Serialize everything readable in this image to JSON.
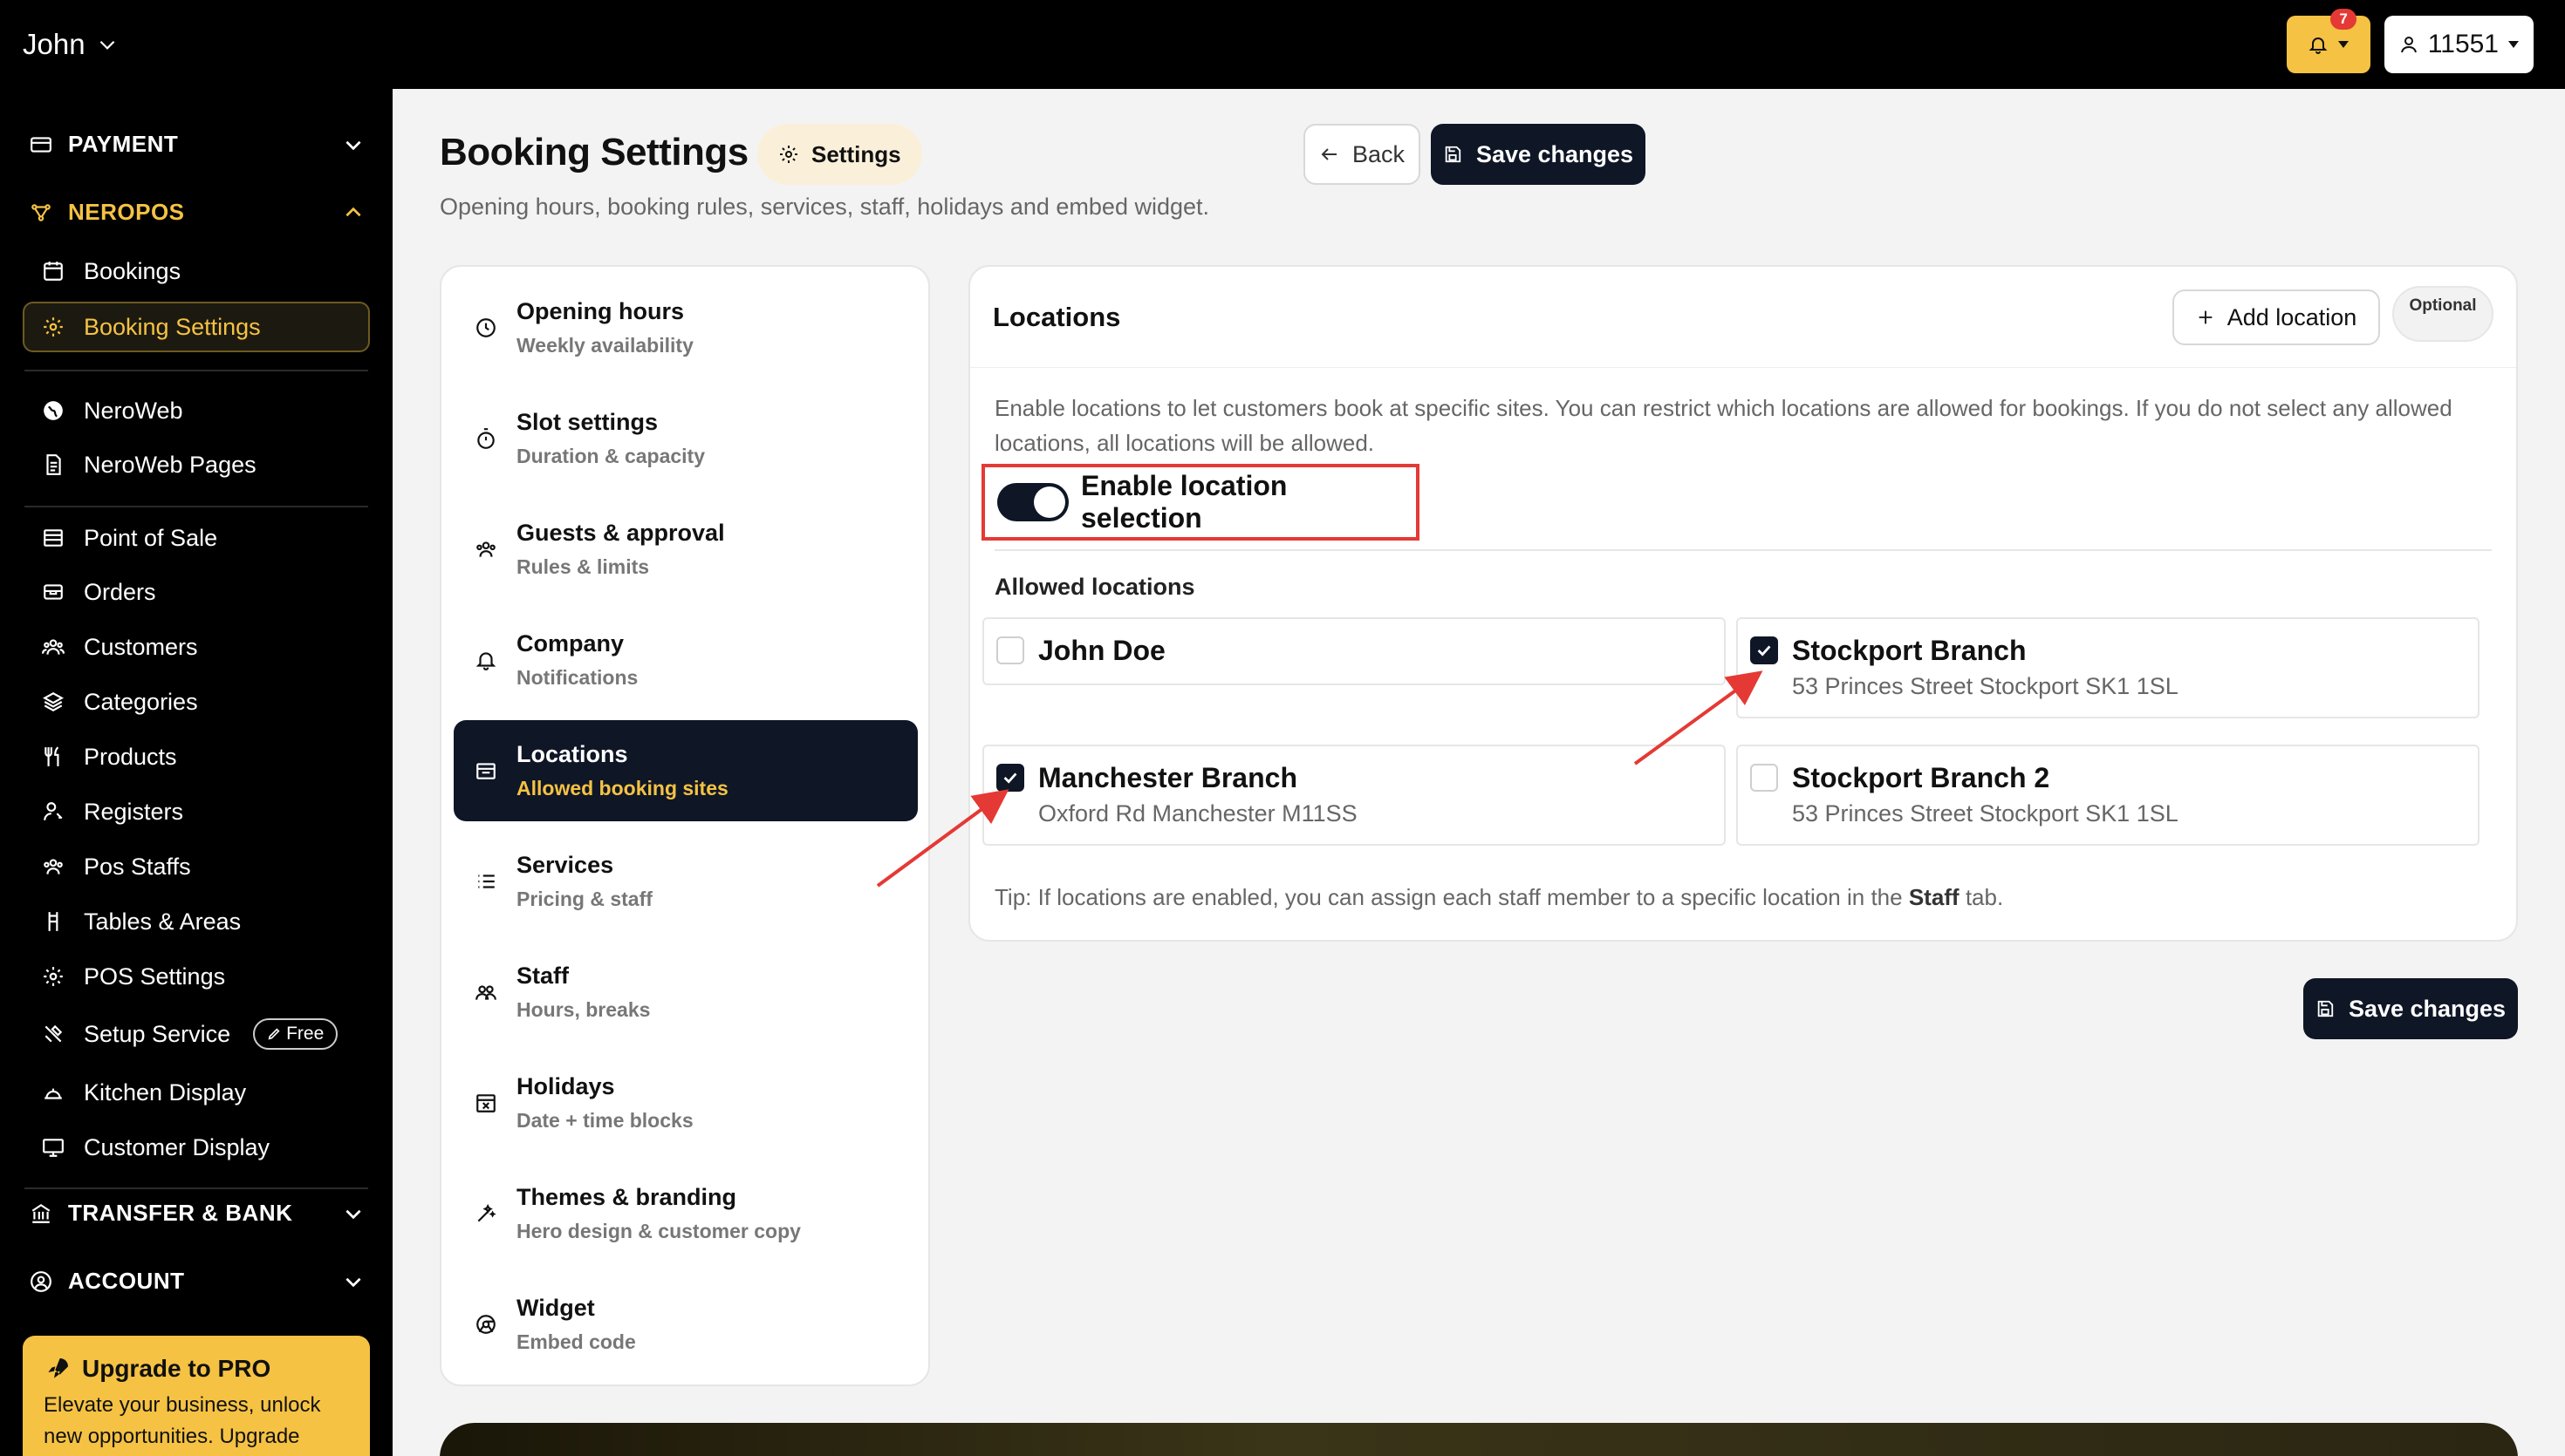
{
  "topbar": {
    "user_name": "John",
    "notification_count": "7",
    "account_id": "11551"
  },
  "sidebar": {
    "sections": {
      "payment": "PAYMENT",
      "neropos": "NEROPOS",
      "transfer_bank": "TRANSFER & BANK",
      "account": "ACCOUNT"
    },
    "items": [
      {
        "label": "Bookings",
        "icon": "calendar-icon"
      },
      {
        "label": "Booking Settings",
        "icon": "gear-icon",
        "active": true
      },
      {
        "label": "NeroWeb",
        "icon": "globe-icon"
      },
      {
        "label": "NeroWeb Pages",
        "icon": "document-icon"
      },
      {
        "label": "Point of Sale",
        "icon": "register-icon"
      },
      {
        "label": "Orders",
        "icon": "orders-icon"
      },
      {
        "label": "Customers",
        "icon": "users-icon"
      },
      {
        "label": "Categories",
        "icon": "layers-icon"
      },
      {
        "label": "Products",
        "icon": "utensils-icon"
      },
      {
        "label": "Registers",
        "icon": "user-key-icon"
      },
      {
        "label": "Pos Staffs",
        "icon": "staff-icon"
      },
      {
        "label": "Tables & Areas",
        "icon": "chair-icon"
      },
      {
        "label": "POS Settings",
        "icon": "gear-icon"
      },
      {
        "label": "Setup Service",
        "icon": "tools-icon",
        "badge": "Free"
      },
      {
        "label": "Kitchen Display",
        "icon": "cloche-icon"
      },
      {
        "label": "Customer Display",
        "icon": "monitor-icon"
      }
    ],
    "upgrade": {
      "title": "Upgrade to PRO",
      "text": "Elevate your business, unlock new opportunities. Upgrade"
    }
  },
  "header": {
    "title": "Booking Settings",
    "chip": "Settings",
    "subtitle": "Opening hours, booking rules, services, staff, holidays and embed widget.",
    "back_label": "Back",
    "save_label": "Save changes"
  },
  "settings_nav": [
    {
      "label": "Opening hours",
      "sub": "Weekly availability",
      "icon": "clock-icon"
    },
    {
      "label": "Slot settings",
      "sub": "Duration & capacity",
      "icon": "stopwatch-icon"
    },
    {
      "label": "Guests & approval",
      "sub": "Rules & limits",
      "icon": "group-icon"
    },
    {
      "label": "Company",
      "sub": "Notifications",
      "icon": "bell-icon"
    },
    {
      "label": "Locations",
      "sub": "Allowed booking sites",
      "icon": "store-icon",
      "active": true
    },
    {
      "label": "Services",
      "sub": "Pricing & staff",
      "icon": "list-icon"
    },
    {
      "label": "Staff",
      "sub": "Hours, breaks",
      "icon": "people-icon"
    },
    {
      "label": "Holidays",
      "sub": "Date + time blocks",
      "icon": "calendar-x-icon"
    },
    {
      "label": "Themes & branding",
      "sub": "Hero design & customer copy",
      "icon": "wand-icon"
    },
    {
      "label": "Widget",
      "sub": "Embed code",
      "icon": "chrome-icon"
    }
  ],
  "locations": {
    "title": "Locations",
    "add_label": "Add location",
    "optional_label": "Optional",
    "description": "Enable locations to let customers book at specific sites. You can restrict which locations are allowed for bookings. If you do not select any allowed locations, all locations will be allowed.",
    "toggle_label": "Enable location selection",
    "toggle_on": true,
    "allowed_title": "Allowed locations",
    "options": [
      {
        "name": "John Doe",
        "address": "",
        "checked": false
      },
      {
        "name": "Stockport Branch",
        "address": "53 Princes Street Stockport SK1 1SL",
        "checked": true
      },
      {
        "name": "Manchester Branch",
        "address": "Oxford Rd Manchester M11SS",
        "checked": true
      },
      {
        "name": "Stockport Branch 2",
        "address": "53 Princes Street Stockport SK1 1SL",
        "checked": false
      }
    ],
    "tip_prefix": "Tip: If locations are enabled, you can assign each staff member to a specific location in the ",
    "tip_bold": "Staff",
    "tip_suffix": " tab."
  },
  "colors": {
    "accent": "#f5c243",
    "dark": "#0f1626",
    "annotation": "#e53935"
  }
}
